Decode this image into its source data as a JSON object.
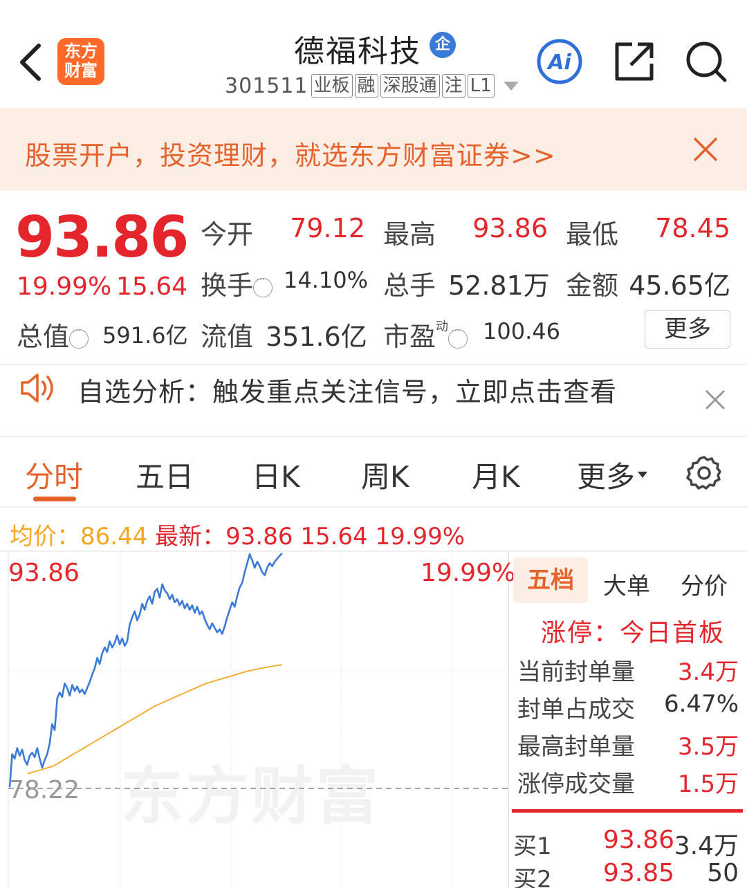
{
  "header": {
    "logo_text_line1": "东方",
    "logo_text_line2": "财富",
    "stock_name": "德福科技",
    "badge": "企",
    "code": "301511",
    "tags": [
      "业板",
      "融",
      "深股通",
      "注",
      "L1"
    ],
    "ai_label": "Ai"
  },
  "banner": {
    "text": "股票开户，投资理财，就选东方财富证券>>"
  },
  "quote": {
    "price": "93.86",
    "change_pct": "19.99%",
    "change_amt": "15.64",
    "fields": {
      "open_label": "今开",
      "open_value": "79.12",
      "high_label": "最高",
      "high_value": "93.86",
      "low_label": "最低",
      "low_value": "78.45",
      "turnover_label": "换手",
      "turnover_value": "14.10%",
      "volume_label": "总手",
      "volume_value": "52.81万",
      "amount_label": "金额",
      "amount_value": "45.65亿",
      "mktcap_label": "总值",
      "mktcap_value": "591.6亿",
      "float_label": "流值",
      "float_value": "351.6亿",
      "pe_label": "市盈",
      "pe_superscript": "动",
      "pe_value": "100.46"
    },
    "more_button": "更多"
  },
  "notice": {
    "text": "自选分析：触发重点关注信号，立即点击查看"
  },
  "tabs": {
    "items": [
      "分时",
      "五日",
      "日K",
      "周K",
      "月K",
      "更多"
    ],
    "active": "分时"
  },
  "chart_info": {
    "avg_label": "均价：",
    "avg_value": "86.44",
    "last_label": "最新：",
    "last_value": "93.86",
    "last_change": "15.64",
    "last_pct": "19.99%"
  },
  "chart_data": {
    "type": "line",
    "title": "",
    "axis_top_price": "93.86",
    "axis_top_pct": "19.99%",
    "reference_price": "78.22",
    "ylim": [
      78.22,
      93.86
    ],
    "watermark": "东方财富",
    "series": [
      {
        "color": "#3a7ad8",
        "values": [
          78.3,
          80.5,
          80.2,
          80.9,
          80.4,
          80.8,
          80.1,
          79.8,
          80.4,
          80.6,
          80.3,
          80.9,
          80.2,
          79.6,
          80.1,
          80.5,
          81.2,
          82.5,
          82.1,
          84.2,
          84.6,
          84.3,
          85.2,
          84.9,
          84.4,
          85.1,
          84.7,
          85.0,
          84.6,
          84.8,
          84.5,
          84.9,
          85.3,
          85.8,
          86.2,
          86.9,
          86.5,
          87.2,
          87.6,
          87.3,
          88.0,
          87.6,
          87.9,
          88.4,
          87.8,
          88.2,
          87.7,
          88.0,
          89.1,
          89.6,
          90.0,
          89.4,
          89.8,
          90.5,
          90.1,
          90.7,
          91.0,
          90.5,
          91.3,
          91.5,
          90.9,
          91.8,
          91.4,
          91.2,
          90.8,
          91.1,
          90.6,
          90.8,
          90.4,
          90.7,
          90.2,
          90.5,
          90.1,
          90.4,
          89.9,
          90.3,
          89.8,
          90.0,
          89.5,
          89.1,
          88.8,
          89.2,
          88.9,
          88.6,
          88.8,
          88.5,
          89.0,
          89.6,
          90.1,
          90.6,
          90.3,
          91.0,
          91.6,
          91.9,
          92.6,
          93.2,
          93.8,
          93.4,
          92.9,
          93.3,
          93.0,
          92.6,
          92.4,
          92.9,
          93.2,
          93.0,
          93.3,
          93.5,
          93.7,
          93.86
        ]
      },
      {
        "color": "#f5a623",
        "values": [
          79.2,
          79.3,
          79.4,
          79.5,
          79.6,
          79.7,
          79.9,
          80.1,
          80.3,
          80.5,
          80.7,
          80.9,
          81.1,
          81.3,
          81.5,
          81.7,
          81.9,
          82.1,
          82.3,
          82.5,
          82.7,
          82.9,
          83.1,
          83.3,
          83.5,
          83.7,
          83.85,
          84.0,
          84.15,
          84.3,
          84.45,
          84.6,
          84.75,
          84.9,
          85.05,
          85.2,
          85.3,
          85.4,
          85.5,
          85.6,
          85.7,
          85.8,
          85.9,
          86.0,
          86.08,
          86.15,
          86.22,
          86.28,
          86.34,
          86.4,
          86.44
        ]
      }
    ]
  },
  "right_panel": {
    "tabs": [
      "五档",
      "大单",
      "分价"
    ],
    "active_tab": "五档",
    "limit_title": "涨停：今日首板",
    "rows": [
      {
        "label": "当前封单量",
        "value": "3.4万",
        "color": "#e4252c"
      },
      {
        "label": "封单占成交",
        "value": "6.47%",
        "color": "#333333"
      },
      {
        "label": "最高封单量",
        "value": "3.5万",
        "color": "#e4252c"
      },
      {
        "label": "涨停成交量",
        "value": "1.5万",
        "color": "#e4252c"
      }
    ],
    "orderbook": [
      {
        "label": "买1",
        "price": "93.86",
        "volume": "3.4万"
      },
      {
        "label": "买2",
        "price": "93.85",
        "volume": "50"
      }
    ]
  },
  "colors": {
    "accent": "#e6622b",
    "up": "#e4252c",
    "price_line": "#3a7ad8",
    "avg_line": "#f5a623"
  }
}
